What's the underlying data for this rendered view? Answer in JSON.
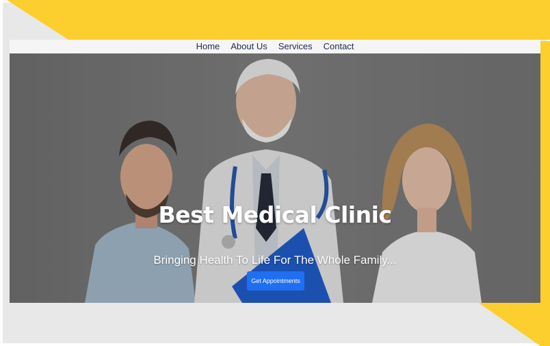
{
  "nav": {
    "items": [
      {
        "label": "Home"
      },
      {
        "label": "About Us"
      },
      {
        "label": "Services"
      },
      {
        "label": "Contact"
      }
    ]
  },
  "hero": {
    "title": "Best Medical Clinic",
    "subtitle": "Bringing Health To Life For The Whole Family...",
    "cta_label": "Get Appointments",
    "image_subject": "three medical professionals: male nurse in scrubs, senior doctor with stethoscope and blue clipboard, female doctor"
  },
  "colors": {
    "accent_yellow": "#fccf2e",
    "frame_gray": "#e8e8e8",
    "nav_text": "#1d2a50",
    "cta_blue": "#1f6ff2"
  }
}
